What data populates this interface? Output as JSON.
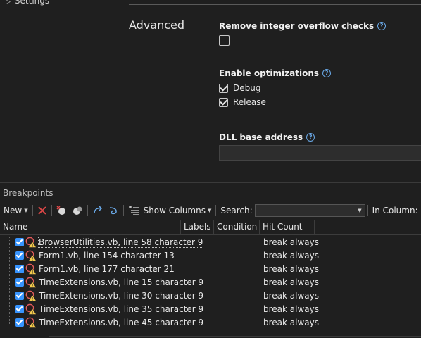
{
  "settings": {
    "nav_item": "Settings",
    "section_title": "Advanced",
    "overflow": {
      "label": "Remove integer overflow checks",
      "checked": false
    },
    "optimizations": {
      "label": "Enable optimizations",
      "debug_label": "Debug",
      "debug_checked": true,
      "release_label": "Release",
      "release_checked": true
    },
    "dll": {
      "label": "DLL base address",
      "value": ""
    }
  },
  "breakpoints": {
    "title": "Breakpoints",
    "toolbar": {
      "new_label": "New",
      "show_columns_label": "Show Columns",
      "search_label": "Search:",
      "search_value": "",
      "in_column_label": "In Column:"
    },
    "columns": [
      "Name",
      "Labels",
      "Condition",
      "Hit Count"
    ],
    "rows": [
      {
        "name": "BrowserUtilities.vb, line 58 character 9",
        "labels": "",
        "condition": "",
        "hit_count": "break always",
        "enabled": true
      },
      {
        "name": "Form1.vb, line 154 character 13",
        "labels": "",
        "condition": "",
        "hit_count": "break always",
        "enabled": true
      },
      {
        "name": "Form1.vb, line 177 character 21",
        "labels": "",
        "condition": "",
        "hit_count": "break always",
        "enabled": true
      },
      {
        "name": "TimeExtensions.vb, line 15 character 9",
        "labels": "",
        "condition": "",
        "hit_count": "break always",
        "enabled": true
      },
      {
        "name": "TimeExtensions.vb, line 30 character 9",
        "labels": "",
        "condition": "",
        "hit_count": "break always",
        "enabled": true
      },
      {
        "name": "TimeExtensions.vb, line 35 character 9",
        "labels": "",
        "condition": "",
        "hit_count": "break always",
        "enabled": true
      },
      {
        "name": "TimeExtensions.vb, line 45 character 9",
        "labels": "",
        "condition": "",
        "hit_count": "break always",
        "enabled": true
      }
    ]
  },
  "colors": {
    "accent": "#3794ff",
    "help": "#6aa9e8",
    "delete": "#e04848",
    "background": "#1f1f1f"
  }
}
